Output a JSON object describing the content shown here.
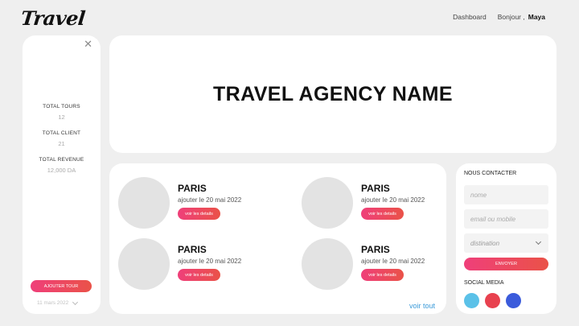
{
  "header": {
    "logo": "Travel",
    "nav_dashboard": "Dashboard",
    "greeting": "Bonjour ,",
    "username": "Maya"
  },
  "sidebar": {
    "close_icon": "close-icon",
    "stats": [
      {
        "label": "TOTAL TOURS",
        "value": "12"
      },
      {
        "label": "TOTAL CLIENT",
        "value": "21"
      },
      {
        "label": "TOTAL REVENUE",
        "value": "12,000 DA"
      }
    ],
    "add_tour_label": "AJOUTER TOUR",
    "date_value": "11 mars 2022"
  },
  "hero": {
    "title": "TRAVEL AGENCY NAME"
  },
  "tours": {
    "items": [
      {
        "city": "PARIS",
        "date": "ajouter le 20 mai 2022",
        "button": "voir les details"
      },
      {
        "city": "PARIS",
        "date": "ajouter le 20 mai 2022",
        "button": "voir les details"
      },
      {
        "city": "PARIS",
        "date": "ajouter le 20 mai 2022",
        "button": "voir les details"
      },
      {
        "city": "PARIS",
        "date": "ajouter le 20 mai 2022",
        "button": "voir les details"
      }
    ],
    "see_all": "voir tout"
  },
  "contact": {
    "title": "NOUS CONTACTER",
    "name_placeholder": "nome",
    "contact_placeholder": "email ou mobile",
    "destination_placeholder": "distination",
    "send_label": "ENVOYER",
    "social_title": "SOCIAL MEDIA",
    "social": [
      {
        "name": "social-icon-1",
        "color": "#5bc1e8"
      },
      {
        "name": "social-icon-2",
        "color": "#e8414f"
      },
      {
        "name": "social-icon-3",
        "color": "#3b5bdb"
      }
    ]
  },
  "colors": {
    "accent_start": "#ef3f7a",
    "accent_end": "#ea5248",
    "link": "#3a9ad9",
    "background": "#efefef"
  }
}
